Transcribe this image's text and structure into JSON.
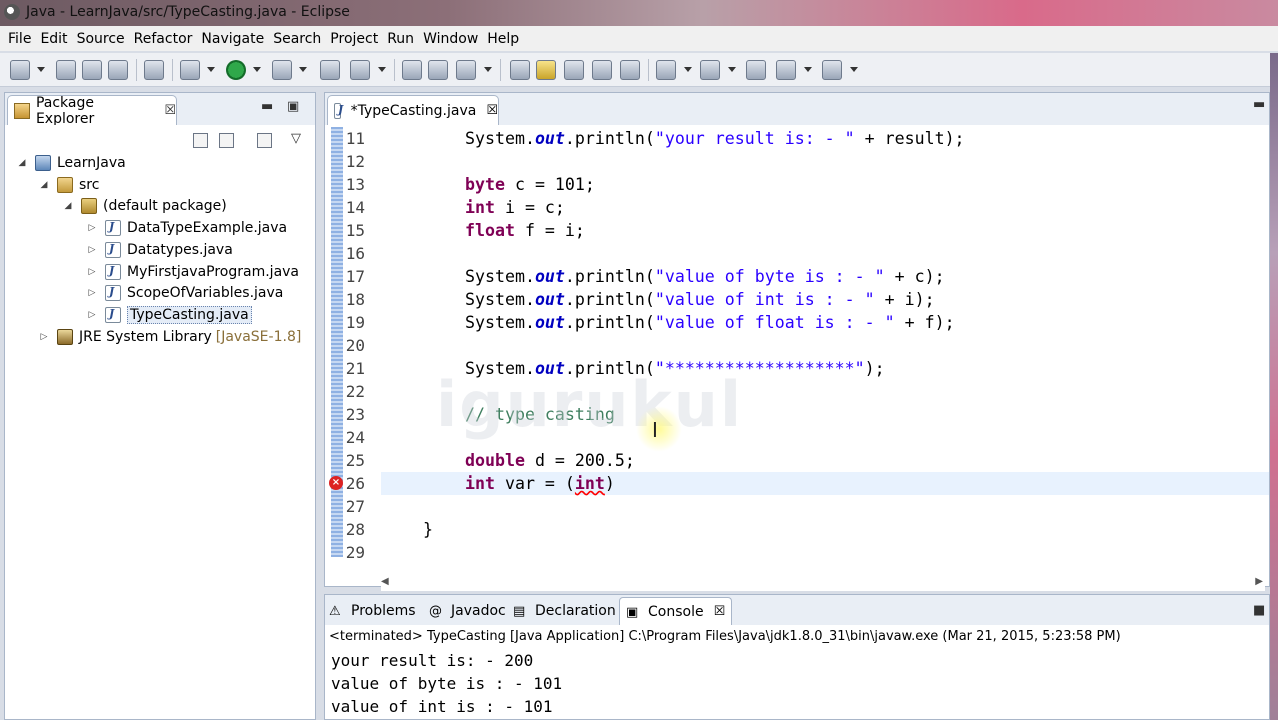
{
  "window": {
    "title": "Java - LearnJava/src/TypeCasting.java - Eclipse"
  },
  "menu": [
    "File",
    "Edit",
    "Source",
    "Refactor",
    "Navigate",
    "Search",
    "Project",
    "Run",
    "Window",
    "Help"
  ],
  "package_explorer": {
    "tab_label": "Package Explorer",
    "close_glyph": "☒",
    "tree": [
      {
        "label": "LearnJava",
        "twisty": "◢",
        "icon": "project-icon",
        "depth": 0
      },
      {
        "label": "src",
        "twisty": "◢",
        "icon": "source-folder-icon",
        "depth": 1
      },
      {
        "label": "(default package)",
        "twisty": "◢",
        "icon": "package-icon",
        "depth": 2
      },
      {
        "label": "DataTypeExample.java",
        "twisty": "▷",
        "icon": "java-file-icon",
        "depth": 3
      },
      {
        "label": "Datatypes.java",
        "twisty": "▷",
        "icon": "java-file-icon",
        "depth": 3
      },
      {
        "label": "MyFirstjavaProgram.java",
        "twisty": "▷",
        "icon": "java-file-icon",
        "depth": 3
      },
      {
        "label": "ScopeOfVariables.java",
        "twisty": "▷",
        "icon": "java-file-icon",
        "depth": 3
      },
      {
        "label": "TypeCasting.java",
        "twisty": "▷",
        "icon": "java-file-icon",
        "depth": 3,
        "selected": true
      },
      {
        "label": "JRE System Library",
        "suffix": "[JavaSE-1.8]",
        "twisty": "▷",
        "icon": "library-icon",
        "depth": 1
      }
    ]
  },
  "editor": {
    "tab_label": "*TypeCasting.java",
    "close_glyph": "☒",
    "lines": [
      {
        "num": "11",
        "text": "System.out.println(\"your result is: - \" + result);"
      },
      {
        "num": "12",
        "text": ""
      },
      {
        "num": "13",
        "text": "byte c = 101;"
      },
      {
        "num": "14",
        "text": "int i = c;"
      },
      {
        "num": "15",
        "text": "float f = i;"
      },
      {
        "num": "16",
        "text": ""
      },
      {
        "num": "17",
        "text": "System.out.println(\"value of byte is : - \" + c);"
      },
      {
        "num": "18",
        "text": "System.out.println(\"value of int is : - \" + i);"
      },
      {
        "num": "19",
        "text": "System.out.println(\"value of float is : - \" + f);"
      },
      {
        "num": "20",
        "text": ""
      },
      {
        "num": "21",
        "text": "System.out.println(\"*******************\");"
      },
      {
        "num": "22",
        "text": ""
      },
      {
        "num": "23",
        "text": "// type casting"
      },
      {
        "num": "24",
        "text": ""
      },
      {
        "num": "25",
        "text": "double d = 200.5;"
      },
      {
        "num": "26",
        "text": "int var = (int)",
        "error": true,
        "current": true
      },
      {
        "num": "27",
        "text": ""
      },
      {
        "num": "28",
        "text": "}"
      },
      {
        "num": "29",
        "text": ""
      }
    ],
    "watermark": "igurukul"
  },
  "bottom_panel": {
    "tabs": [
      {
        "label": "Problems",
        "icon": "problems-icon"
      },
      {
        "label": "Javadoc",
        "icon": "at-icon"
      },
      {
        "label": "Declaration",
        "icon": "declaration-icon"
      },
      {
        "label": "Console",
        "icon": "console-icon",
        "active": true
      }
    ],
    "console_header": "<terminated> TypeCasting [Java Application] C:\\Program Files\\Java\\jdk1.8.0_31\\bin\\javaw.exe (Mar 21, 2015, 5:23:58 PM)",
    "output": [
      "your result is: - 200",
      "value of byte is : - 101",
      "value of int is : - 101"
    ]
  }
}
